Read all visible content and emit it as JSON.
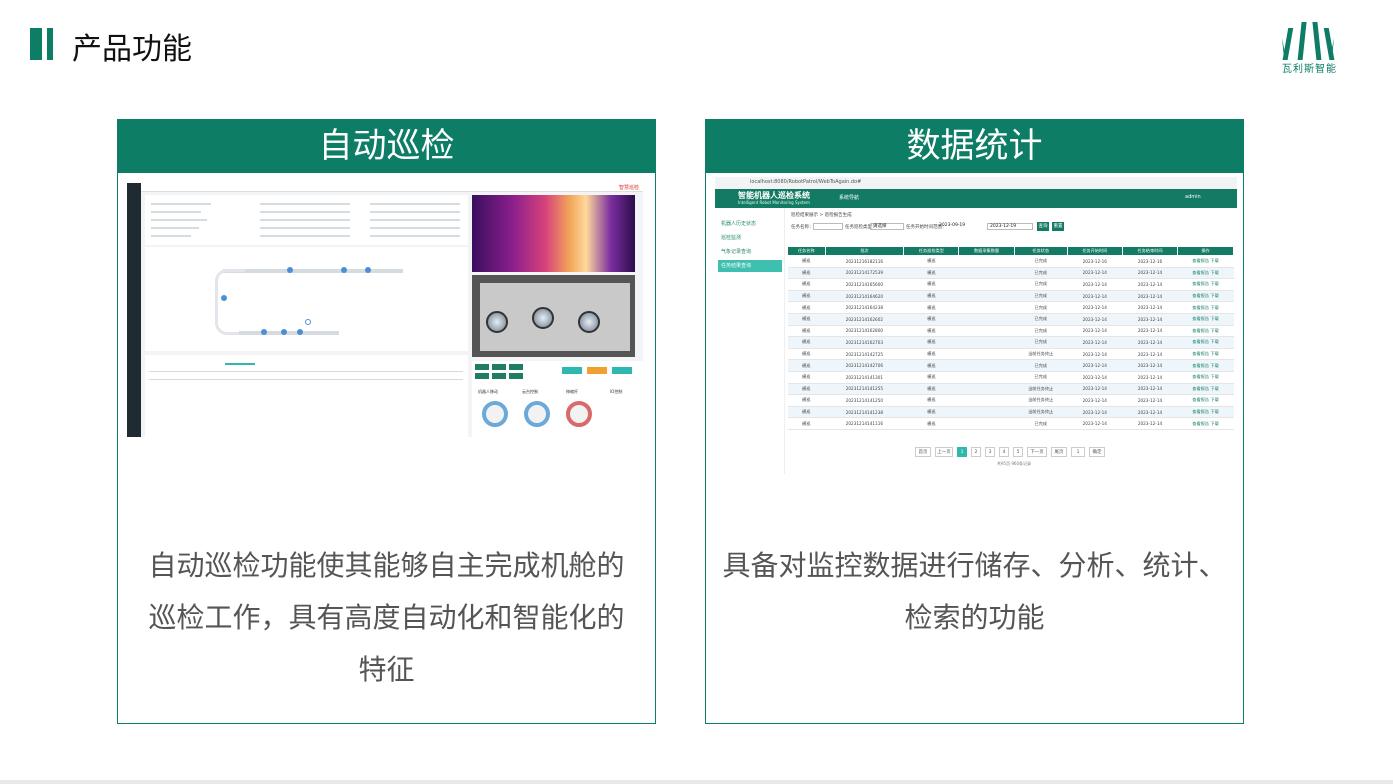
{
  "page": {
    "title": "产品功能",
    "logo_text": "瓦利斯智能",
    "accent": "#0e7d66"
  },
  "cards": [
    {
      "heading": "自动巡检",
      "description_lines": [
        "自动巡检功能使其能够自主完成机舱的",
        "巡检工作，具有高度自动化和智能化的",
        "特征"
      ],
      "screenshot": {
        "top_right": "智慧巡检",
        "control_label_a": "机器人移动",
        "control_label_b": "云台控制",
        "control_label_c": "伸缩杆",
        "control_label_d": "IO控制"
      }
    },
    {
      "heading": "数据统计",
      "description_lines": [
        "具备对监控数据进行储存、分析、统计、",
        "检索的功能"
      ],
      "screenshot": {
        "url": "localhost:8080/RobotPatrol/WebToAgain.do#",
        "system_name": "智能机器人巡检系统",
        "system_name_en": "Intelligent Robot Monitoring System",
        "menu_label": "系统导航",
        "user": "admin",
        "breadcrumb": "巡检结果展示 > 巡检报告生成",
        "filter_task_label": "任务名称：",
        "filter_type_label": "任务巡检类型：",
        "filter_type_value": "请选择",
        "filter_time_label": "任务开始时间范围：",
        "date_start": "2023-09-19",
        "date_end": "2023-12-19",
        "search_btn": "查询",
        "reset_btn": "重置",
        "sidebar": [
          "机器人历史状态",
          "巡检监测",
          "气象记录查询",
          "任务结果查询"
        ],
        "table": {
          "headers": [
            "任务名称",
            "批次",
            "任务巡检类型",
            "数据采集数量",
            "任务状态",
            "任务开始时间",
            "任务结束时间",
            "操作"
          ],
          "rows": [
            [
              "横巡",
              "20231216182116",
              "横巡",
              "",
              "已完成",
              "2023-12-16",
              "2023-12-16",
              "查看报告 下载"
            ],
            [
              "横巡",
              "20231214172539",
              "横巡",
              "",
              "已完成",
              "2023-12-14",
              "2023-12-14",
              "查看报告 下载"
            ],
            [
              "横巡",
              "20231214165600",
              "横巡",
              "",
              "已完成",
              "2023-12-14",
              "2023-12-14",
              "查看报告 下载"
            ],
            [
              "横巡",
              "20231214164620",
              "横巡",
              "",
              "已完成",
              "2023-12-14",
              "2023-12-14",
              "查看报告 下载"
            ],
            [
              "横巡",
              "20231214164238",
              "横巡",
              "",
              "已完成",
              "2023-12-14",
              "2023-12-14",
              "查看报告 下载"
            ],
            [
              "横巡",
              "20231214162602",
              "横巡",
              "",
              "已完成",
              "2023-12-14",
              "2023-12-14",
              "查看报告 下载"
            ],
            [
              "横巡",
              "20231214162800",
              "横巡",
              "",
              "已完成",
              "2023-12-14",
              "2023-12-14",
              "查看报告 下载"
            ],
            [
              "横巡",
              "20231214162703",
              "横巡",
              "",
              "已完成",
              "2023-12-14",
              "2023-12-14",
              "查看报告 下载"
            ],
            [
              "横巡",
              "20231214142725",
              "横巡",
              "",
              "当前任务终止",
              "2023-12-14",
              "2023-12-14",
              "查看报告 下载"
            ],
            [
              "横巡",
              "20231214142706",
              "横巡",
              "",
              "已完成",
              "2023-12-14",
              "2023-12-14",
              "查看报告 下载"
            ],
            [
              "横巡",
              "20231214141301",
              "横巡",
              "",
              "已完成",
              "2023-12-14",
              "2023-12-14",
              "查看报告 下载"
            ],
            [
              "横巡",
              "20231214141255",
              "横巡",
              "",
              "当前任务终止",
              "2023-12-14",
              "2023-12-14",
              "查看报告 下载"
            ],
            [
              "横巡",
              "20231214141250",
              "横巡",
              "",
              "当前任务终止",
              "2023-12-14",
              "2023-12-14",
              "查看报告 下载"
            ],
            [
              "横巡",
              "20231214141238",
              "横巡",
              "",
              "当前任务终止",
              "2023-12-14",
              "2023-12-14",
              "查看报告 下载"
            ],
            [
              "横巡",
              "20231214141116",
              "横巡",
              "",
              "已完成",
              "2023-12-14",
              "2023-12-14",
              "查看报告 下载"
            ]
          ]
        },
        "pager": [
          "首页",
          "上一页",
          "1",
          "2",
          "3",
          "4",
          "5",
          "下一页",
          "尾页",
          "1",
          "确定"
        ],
        "pager_info": "共95页 960条记录"
      }
    }
  ]
}
